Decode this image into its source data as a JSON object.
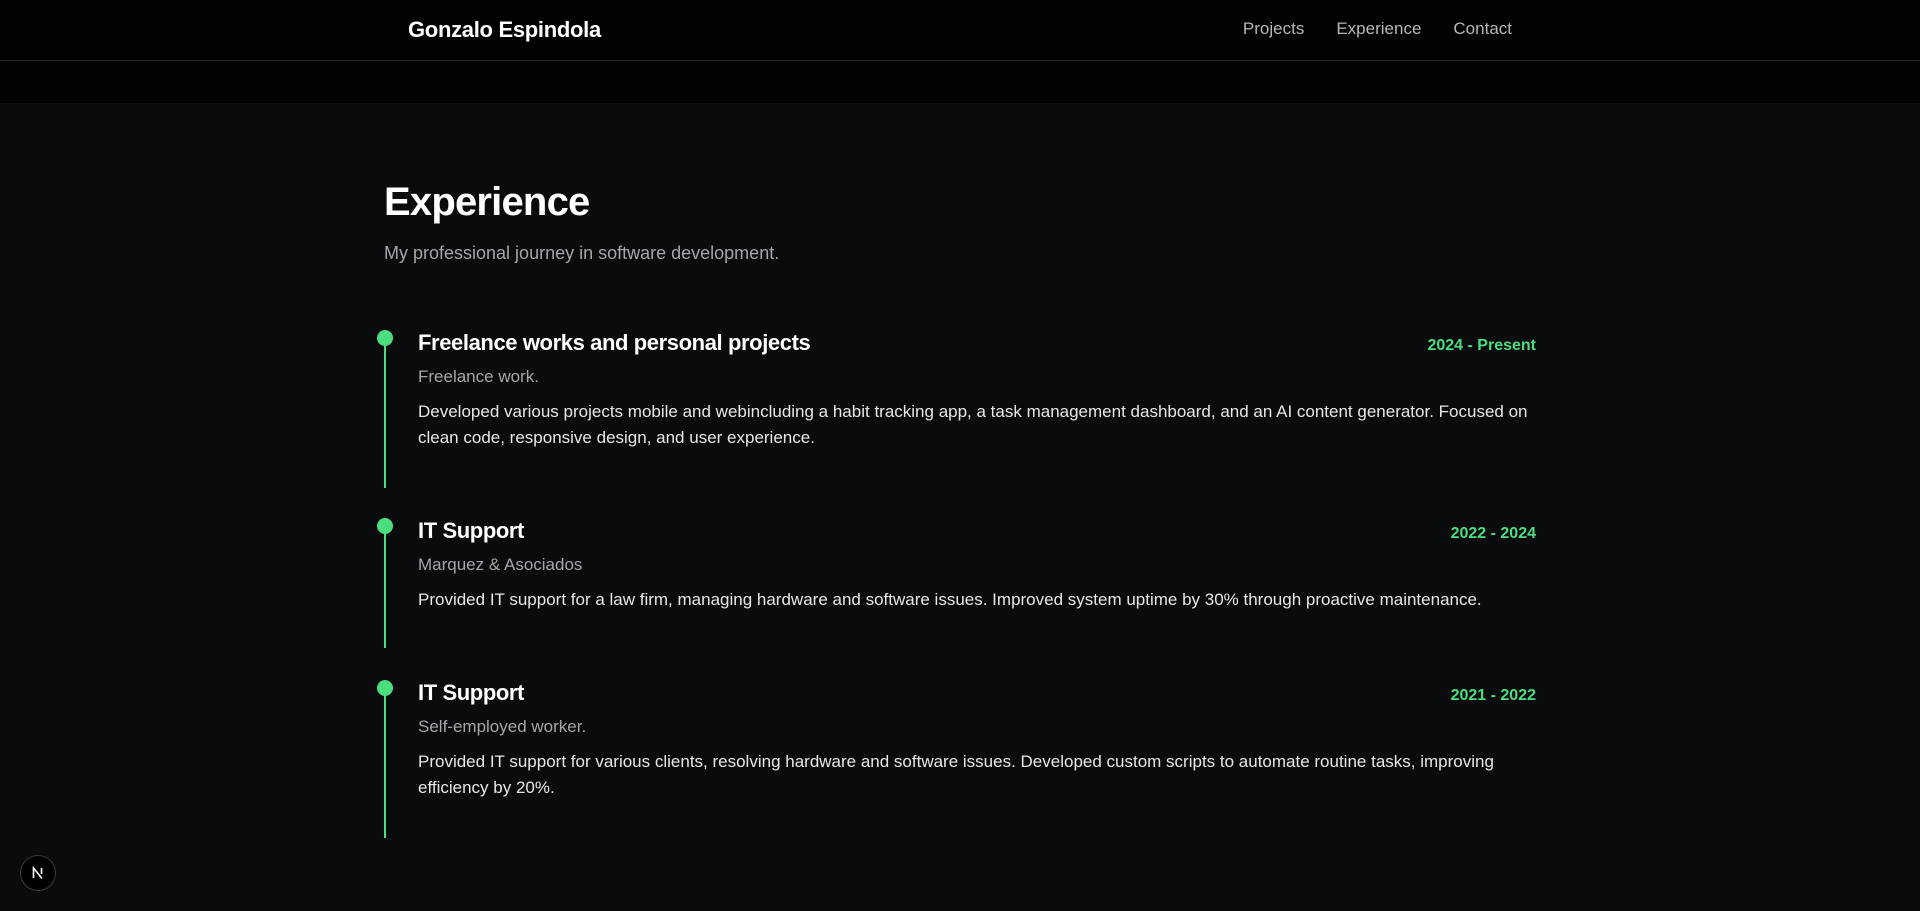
{
  "header": {
    "brand": "Gonzalo Espindola",
    "nav": [
      {
        "label": "Projects"
      },
      {
        "label": "Experience"
      },
      {
        "label": "Contact"
      }
    ]
  },
  "experience": {
    "title": "Experience",
    "subtitle": "My professional journey in software development.",
    "items": [
      {
        "title": "Freelance works and personal projects",
        "date": "2024 - Present",
        "company": "Freelance work.",
        "description": "Developed various projects mobile and webincluding a habit tracking app, a task management dashboard, and an AI content generator. Focused on clean code, responsive design, and user experience."
      },
      {
        "title": "IT Support",
        "date": "2022 - 2024",
        "company": "Marquez & Asociados",
        "description": "Provided IT support for a law firm, managing hardware and software issues. Improved system uptime by 30% through proactive maintenance."
      },
      {
        "title": "IT Support",
        "date": "2021 - 2022",
        "company": "Self-employed worker.",
        "description": "Provided IT support for various clients, resolving hardware and software issues. Developed custom scripts to automate routine tasks, improving efficiency by 20%."
      }
    ]
  },
  "badge": {
    "icon": "nextjs-logo-icon",
    "letter": "N"
  },
  "colors": {
    "accent": "#4ade80",
    "background": "#0a0b0d",
    "header_background": "#020202"
  }
}
